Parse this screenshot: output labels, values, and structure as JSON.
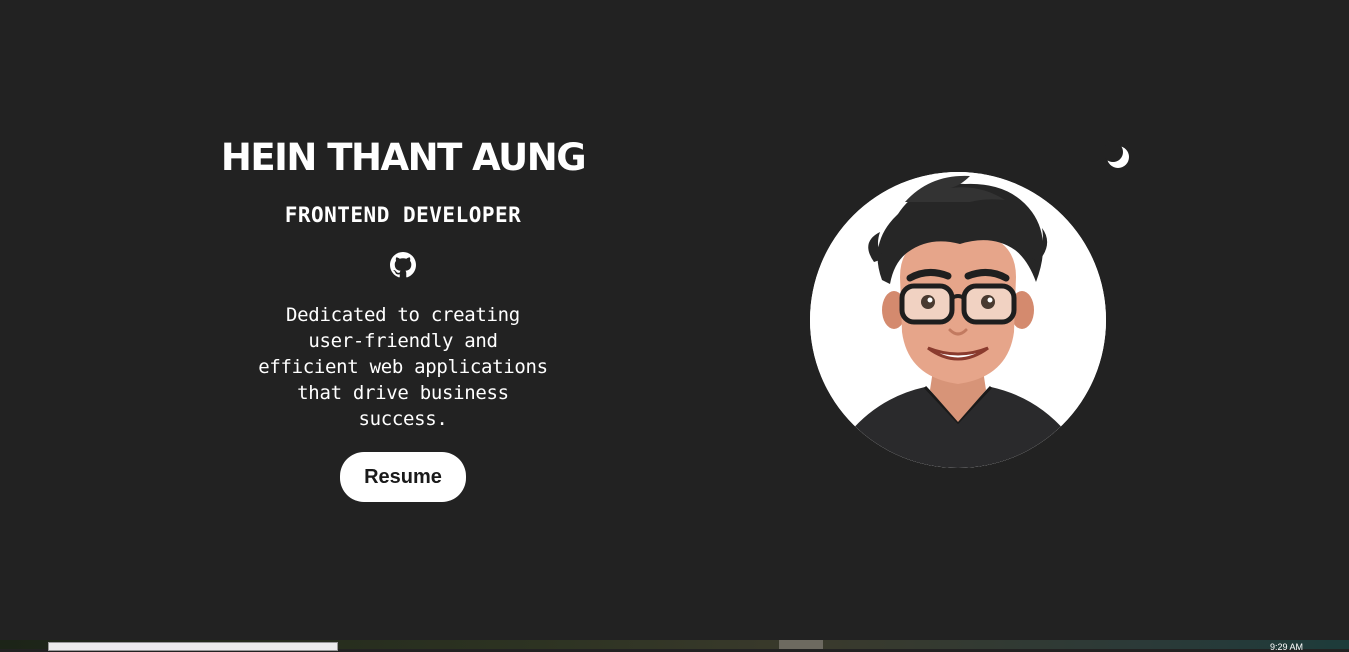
{
  "hero": {
    "name": "HEIN THANT AUNG",
    "role": "FRONTEND DEVELOPER",
    "bio": "Dedicated to creating user-friendly and efficient web applications that drive business success.",
    "resume_label": "Resume",
    "github_icon": "github-icon"
  },
  "theme_toggle": {
    "icon": "moon-icon"
  },
  "avatar": {
    "icon": "cartoon-avatar"
  },
  "taskbar": {
    "clock": "9:29 AM"
  },
  "colors": {
    "background": "#222222",
    "text": "#ffffff",
    "button_bg": "#ffffff",
    "button_text": "#1a1a1a"
  }
}
